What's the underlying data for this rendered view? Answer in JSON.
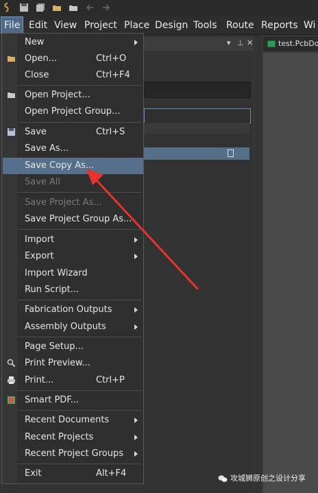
{
  "menubar": {
    "items": [
      "File",
      "Edit",
      "View",
      "Project",
      "Place",
      "Design",
      "Tools",
      "Route",
      "Reports",
      "Wi"
    ]
  },
  "document_tab": {
    "label": "test.PcbDoc"
  },
  "file_menu": {
    "new": "New",
    "open": "Open...",
    "open_shortcut": "Ctrl+O",
    "close": "Close",
    "close_shortcut": "Ctrl+F4",
    "open_project": "Open Project...",
    "open_project_group": "Open Project Group...",
    "save": "Save",
    "save_shortcut": "Ctrl+S",
    "save_as": "Save As...",
    "save_copy_as": "Save Copy As...",
    "save_all": "Save All",
    "save_project_as": "Save Project As...",
    "save_project_group_as": "Save Project Group As...",
    "import": "Import",
    "export": "Export",
    "import_wizard": "Import Wizard",
    "run_script": "Run Script...",
    "fabrication_outputs": "Fabrication Outputs",
    "assembly_outputs": "Assembly Outputs",
    "page_setup": "Page Setup...",
    "print_preview": "Print Preview...",
    "print": "Print...",
    "print_shortcut": "Ctrl+P",
    "smart_pdf": "Smart PDF...",
    "recent_documents": "Recent Documents",
    "recent_projects": "Recent Projects",
    "recent_project_groups": "Recent Project Groups",
    "exit": "Exit",
    "exit_shortcut": "Alt+F4"
  },
  "watermark": {
    "text": "攻城狮原创之设计分享"
  },
  "colors": {
    "highlight": "#566f8b",
    "arrow": "#e8332d",
    "menu_bg": "#2f2f2f"
  }
}
